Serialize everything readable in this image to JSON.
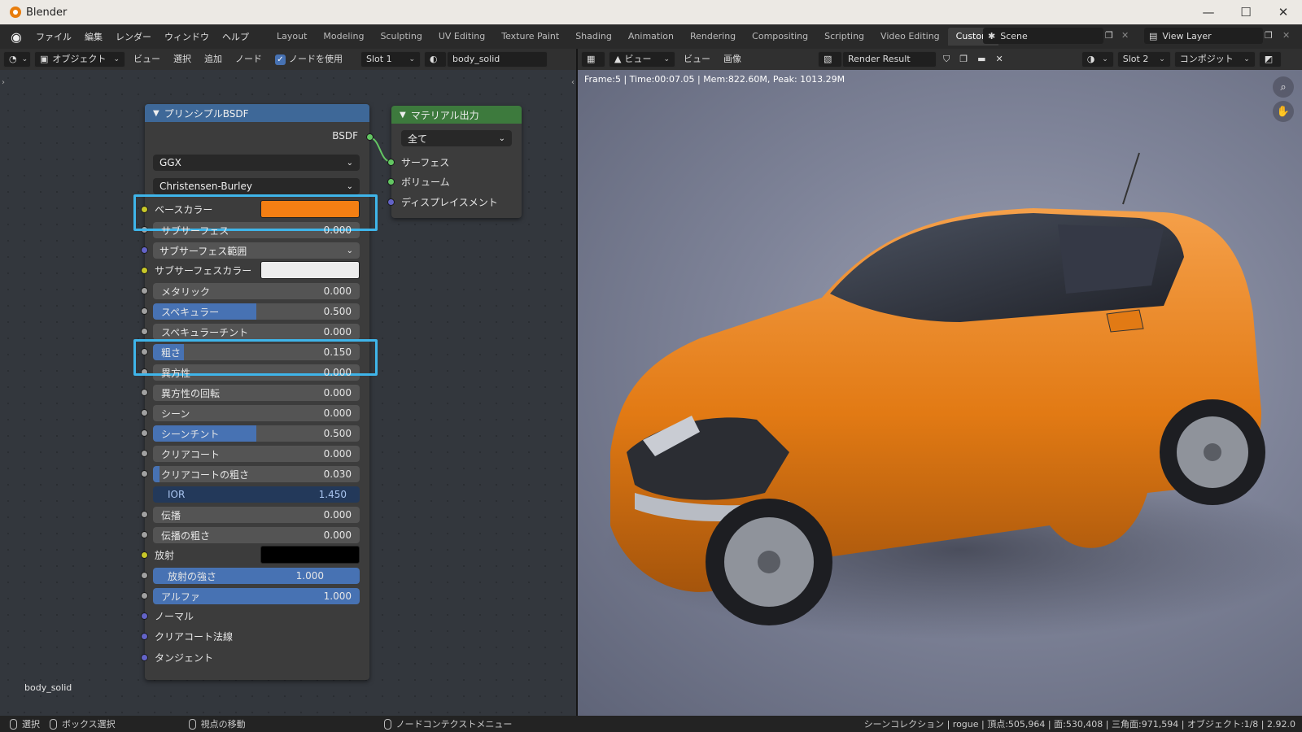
{
  "window": {
    "title": "Blender",
    "minimize": "—",
    "maximize": "☐",
    "close": "✕"
  },
  "menu": {
    "items": [
      "ファイル",
      "編集",
      "レンダー",
      "ウィンドウ",
      "ヘルプ"
    ]
  },
  "workspaces": [
    "Layout",
    "Modeling",
    "Sculpting",
    "UV Editing",
    "Texture Paint",
    "Shading",
    "Animation",
    "Rendering",
    "Compositing",
    "Scripting",
    "Video Editing",
    "Custom"
  ],
  "active_workspace": "Custom",
  "scene": {
    "name": "Scene",
    "view_layer": "View Layer"
  },
  "node_editor": {
    "mode": "オブジェクト",
    "menus": [
      "ビュー",
      "選択",
      "追加",
      "ノード"
    ],
    "use_nodes_label": "ノードを使用",
    "slot": "Slot 1",
    "material": "body_solid",
    "object_label": "body_solid"
  },
  "bsdf": {
    "title": "プリンシプルBSDF",
    "output": "BSDF",
    "distribution": "GGX",
    "subsurface_method": "Christensen-Burley",
    "base_color_label": "ベースカラー",
    "base_color": "#f47f13",
    "subsurface": {
      "label": "サブサーフェス",
      "value": "0.000"
    },
    "subsurface_radius": "サブサーフェス範囲",
    "subsurface_color_label": "サブサーフェスカラー",
    "subsurface_color": "#ededed",
    "metallic": {
      "label": "メタリック",
      "value": "0.000"
    },
    "specular": {
      "label": "スペキュラー",
      "value": "0.500",
      "fraction": 0.5
    },
    "specular_tint": {
      "label": "スペキュラーチント",
      "value": "0.000"
    },
    "roughness": {
      "label": "粗さ",
      "value": "0.150",
      "fraction": 0.15
    },
    "anisotropic": {
      "label": "異方性",
      "value": "0.000"
    },
    "anisotropic_rotation": {
      "label": "異方性の回転",
      "value": "0.000"
    },
    "sheen": {
      "label": "シーン",
      "value": "0.000"
    },
    "sheen_tint": {
      "label": "シーンチント",
      "value": "0.500",
      "fraction": 0.5
    },
    "clearcoat": {
      "label": "クリアコート",
      "value": "0.000"
    },
    "clearcoat_roughness": {
      "label": "クリアコートの粗さ",
      "value": "0.030",
      "fraction": 0.03
    },
    "ior": {
      "label": "IOR",
      "value": "1.450"
    },
    "transmission": {
      "label": "伝播",
      "value": "0.000"
    },
    "transmission_roughness": {
      "label": "伝播の粗さ",
      "value": "0.000"
    },
    "emission_label": "放射",
    "emission_color": "#000000",
    "emission_strength": {
      "label": "放射の強さ",
      "value": "1.000"
    },
    "alpha": {
      "label": "アルファ",
      "value": "1.000"
    },
    "normal": "ノーマル",
    "clearcoat_normal": "クリアコート法線",
    "tangent": "タンジェント"
  },
  "material_output": {
    "title": "マテリアル出力",
    "target": "全て",
    "surface": "サーフェス",
    "volume": "ボリューム",
    "displacement": "ディスプレイスメント"
  },
  "image_editor": {
    "view_label": "ビュー",
    "menus": [
      "ビュー",
      "画像"
    ],
    "image": "Render Result",
    "slot": "Slot 2",
    "pass": "コンポジット",
    "info": "Frame:5 | Time:00:07.05 | Mem:822.60M, Peak: 1013.29M"
  },
  "status": {
    "select": "選択",
    "box_select": "ボックス選択",
    "pan": "視点の移動",
    "context_menu": "ノードコンテクストメニュー",
    "stats": "シーンコレクション | rogue | 頂点:505,964 | 面:530,408 | 三角面:971,594 | オブジェクト:1/8 | 2.92.0"
  }
}
